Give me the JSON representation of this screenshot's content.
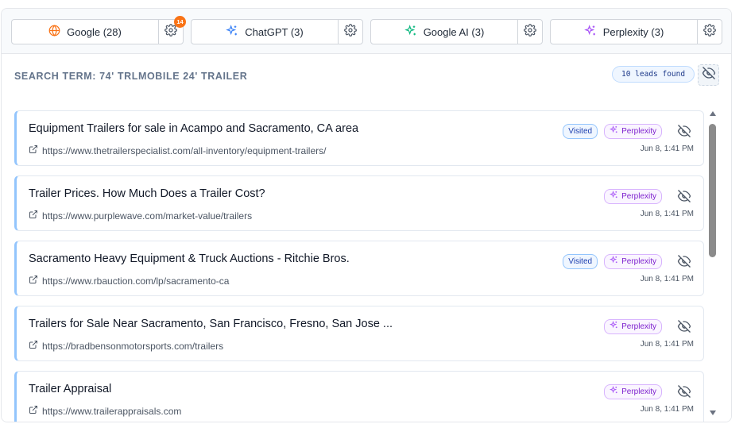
{
  "tabs": [
    {
      "label": "Google (28)",
      "icon": "globe-icon",
      "icon_color": "#f97316",
      "notification": "14"
    },
    {
      "label": "ChatGPT (3)",
      "icon": "sparkle-icon",
      "icon_color": "#3b82f6"
    },
    {
      "label": "Google AI (3)",
      "icon": "sparkle-icon",
      "icon_color": "#10b981"
    },
    {
      "label": "Perplexity (3)",
      "icon": "sparkle-icon",
      "icon_color": "#a855f7"
    }
  ],
  "search": {
    "term_label": "Search term: 74' trlmobile 24' trailer",
    "leads_found": "10 leads found"
  },
  "leads": [
    {
      "title": "Equipment Trailers for sale in Acampo and Sacramento, CA area",
      "url": "https://www.thetrailerspecialist.com/all-inventory/equipment-trailers/",
      "visited": "Visited",
      "source": "Perplexity",
      "time": "Jun 8, 1:41 PM"
    },
    {
      "title": "Trailer Prices. How Much Does a Trailer Cost?",
      "url": "https://www.purplewave.com/market-value/trailers",
      "visited": "",
      "source": "Perplexity",
      "time": "Jun 8, 1:41 PM"
    },
    {
      "title": "Sacramento Heavy Equipment & Truck Auctions - Ritchie Bros.",
      "url": "https://www.rbauction.com/lp/sacramento-ca",
      "visited": "Visited",
      "source": "Perplexity",
      "time": "Jun 8, 1:41 PM"
    },
    {
      "title": "Trailers for Sale Near Sacramento, San Francisco, Fresno, San Jose ...",
      "url": "https://bradbensonmotorsports.com/trailers",
      "visited": "",
      "source": "Perplexity",
      "time": "Jun 8, 1:41 PM"
    },
    {
      "title": "Trailer Appraisal",
      "url": "https://www.trailerappraisals.com",
      "visited": "",
      "source": "Perplexity",
      "time": "Jun 8, 1:41 PM"
    }
  ],
  "colors": {
    "accent": "#93c5fd",
    "perplexity": "#a855f7",
    "notification": "#f97316"
  }
}
